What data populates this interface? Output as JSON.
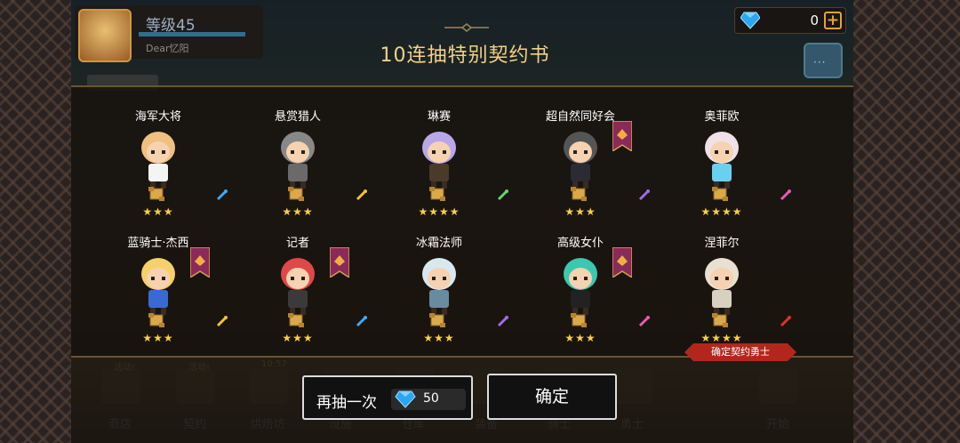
{
  "player": {
    "level": "等级45",
    "name": "Dear忆阳"
  },
  "currency": {
    "gems": "0",
    "plus": "+"
  },
  "chat": {
    "dots": "···"
  },
  "dialog": {
    "title": "10连抽特别契约书",
    "heroes": [
      {
        "name": "海军大将",
        "stars": "★★★",
        "weapon_color": "#3fa9f5",
        "hair": "#f0c080",
        "outfit": "#f4f4f4",
        "banner": false
      },
      {
        "name": "悬赏猎人",
        "stars": "★★★",
        "weapon_color": "#f2c230",
        "hair": "#888888",
        "outfit": "#6a6a6a",
        "banner": false
      },
      {
        "name": "琳赛",
        "stars": "★★★★",
        "weapon_color": "#6ad36a",
        "hair": "#b9a7e8",
        "outfit": "#4a3a2a",
        "banner": false
      },
      {
        "name": "超自然同好会",
        "stars": "★★★",
        "weapon_color": "#a56ae8",
        "hair": "#555555",
        "outfit": "#2b2b33",
        "banner": true
      },
      {
        "name": "奥菲欧",
        "stars": "★★★★",
        "weapon_color": "#e85ab8",
        "hair": "#f0e0e8",
        "outfit": "#6ad0f0",
        "banner": false
      },
      {
        "name": "蓝骑士·杰西",
        "stars": "★★★",
        "weapon_color": "#f2c230",
        "hair": "#f6d06a",
        "outfit": "#3a6ad0",
        "banner": true
      },
      {
        "name": "记者",
        "stars": "★★★",
        "weapon_color": "#3fa9f5",
        "hair": "#e04848",
        "outfit": "#3a3a3a",
        "banner": true
      },
      {
        "name": "冰霜法师",
        "stars": "★★★",
        "weapon_color": "#a56ae8",
        "hair": "#d8e8f0",
        "outfit": "#6a8aa0",
        "banner": false
      },
      {
        "name": "高级女仆",
        "stars": "★★★",
        "weapon_color": "#e85ab8",
        "hair": "#3ac8b0",
        "outfit": "#222222",
        "banner": true
      },
      {
        "name": "涅菲尔",
        "stars": "★★★★",
        "weapon_color": "#e03030",
        "hair": "#e8e0d0",
        "outfit": "#d8d0c0",
        "banner": false
      }
    ],
    "confirm_tag": "确定契约勇士"
  },
  "buttons": {
    "again_label": "再抽一次",
    "again_cost": "50",
    "ok_label": "确定"
  },
  "nav": {
    "items": [
      {
        "label": "商店",
        "bubble": "活动!"
      },
      {
        "label": "契约",
        "bubble": "活动!"
      },
      {
        "label": "烘焙坊",
        "bubble": "10:57"
      },
      {
        "label": "设施",
        "bubble": ""
      },
      {
        "label": "仓库",
        "bubble": ""
      },
      {
        "label": "装备",
        "bubble": ""
      },
      {
        "label": "骑士",
        "bubble": ""
      },
      {
        "label": "勇士",
        "bubble": ""
      },
      {
        "label": "开始",
        "bubble": ""
      }
    ]
  },
  "colors": {
    "title": "#f4d089",
    "star": "#f8d043",
    "tag": "#b3261e",
    "banner": "#8a2a5a"
  }
}
